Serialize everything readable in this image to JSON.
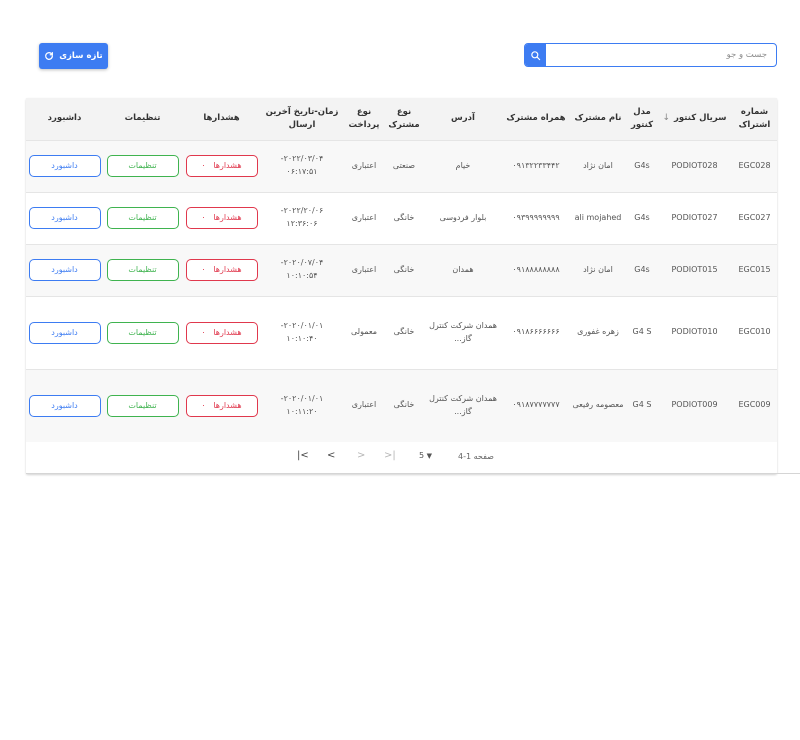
{
  "toolbar": {
    "refresh_label": "تازه سازی",
    "search_placeholder": "جست و جو"
  },
  "table": {
    "columns": [
      "شماره اشتراک",
      "سریال کنتور",
      "مدل کنتور",
      "نام مشترک",
      "همراه مشترک",
      "آدرس",
      "نوع مشترک",
      "نوع پرداخت",
      "زمان-تاریخ آخرین ارسال",
      "هشدارها",
      "تنظیمات",
      "داشبورد"
    ],
    "rows": [
      {
        "subscription": "EGC028",
        "serial": "PODIOT028",
        "model": "G4s",
        "name": "امان نژاد",
        "phone": "۰۹۱۳۲۲۳۳۴۴۲",
        "address": "خیام",
        "customer_type": "صنعتی",
        "payment_type": "اعتباری",
        "last_send": "۲۰۲۲/۰۳/۰۴- ۰۶:۱۷:۵۱",
        "alarm_count": "۰",
        "alarm_label": "هشدارها",
        "settings_label": "تنظیمات",
        "dashboard_label": "داشبورد"
      },
      {
        "subscription": "EGC027",
        "serial": "PODIOT027",
        "model": "G4s",
        "name": "ali mojahed",
        "phone": "۰۹۳۹۹۹۹۹۹۹۹",
        "address": "بلوار فردوسی",
        "customer_type": "خانگی",
        "payment_type": "اعتباری",
        "last_send": "۲۰۲۲/۲۰/۰۶- ۱۲:۳۶:۰۶",
        "alarm_count": "۰",
        "alarm_label": "هشدارها",
        "settings_label": "تنظیمات",
        "dashboard_label": "داشبورد"
      },
      {
        "subscription": "EGC015",
        "serial": "PODIOT015",
        "model": "G4s",
        "name": "امان نژاد",
        "phone": "۰۹۱۸۸۸۸۸۸۸۸",
        "address": "همدان",
        "customer_type": "خانگی",
        "payment_type": "اعتباری",
        "last_send": "۲۰۲۰/۰۷/۰۴- ۱۰:۱۰:۵۴",
        "alarm_count": "۰",
        "alarm_label": "هشدارها",
        "settings_label": "تنظیمات",
        "dashboard_label": "داشبورد"
      },
      {
        "subscription": "EGC010",
        "serial": "PODIOT010",
        "model": "G4 S",
        "name": "زهره غفوری",
        "phone": "۰۹۱۸۶۶۶۶۶۶۶",
        "address": "همدان شرکت کنترل گاز...",
        "customer_type": "خانگی",
        "payment_type": "معمولی",
        "last_send": "۲۰۲۰/۰۱/۰۱- ۱۰:۱۰:۴۰",
        "alarm_count": "۰",
        "alarm_label": "هشدارها",
        "settings_label": "تنظیمات",
        "dashboard_label": "داشبورد"
      },
      {
        "subscription": "EGC009",
        "serial": "PODIOT009",
        "model": "G4 S",
        "name": "معصومه رفیعی",
        "phone": "۰۹۱۸۷۷۷۷۷۷۷",
        "address": "همدان شرکت کنترل گاز...",
        "customer_type": "خانگی",
        "payment_type": "اعتباری",
        "last_send": "۲۰۲۰/۰۱/۰۱- ۱۰:۱۱:۲۰",
        "alarm_count": "۰",
        "alarm_label": "هشدارها",
        "settings_label": "تنظیمات",
        "dashboard_label": "داشبورد"
      }
    ]
  },
  "pagination": {
    "range_label": "صفحه 1-4",
    "rows_per_page": "5"
  },
  "colors": {
    "primary": "#3d7cf2",
    "alarm": "#e0384d",
    "settings": "#3fb34f"
  },
  "icons": {
    "refresh": "refresh-icon",
    "search": "search-icon",
    "sort": "arrow-down-icon",
    "first": "first-page-icon",
    "prev": "chevron-left-icon",
    "next": "chevron-right-icon",
    "last": "last-page-icon",
    "dropdown": "caret-down-icon"
  }
}
